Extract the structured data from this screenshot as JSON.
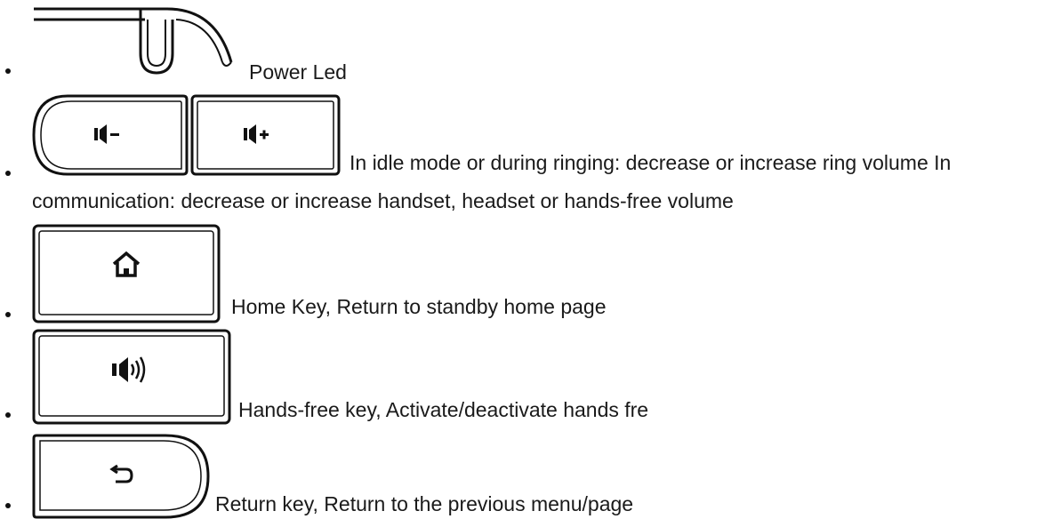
{
  "items": [
    {
      "icon": "power-led-icon",
      "text": "Power Led"
    },
    {
      "icon": "volume-keys-icon",
      "text": "In idle mode or during ringing: decrease or increase ring volume In",
      "text_cont": "communication: decrease or increase handset, headset or hands-free volume"
    },
    {
      "icon": "home-key-icon",
      "text": "Home Key, Return to standby home page"
    },
    {
      "icon": "hands-free-key-icon",
      "text": "Hands-free key, Activate/deactivate hands fre"
    },
    {
      "icon": "return-key-icon",
      "text": "Return key, Return to the previous menu/page"
    }
  ],
  "colors": {
    "text": "#1a1a1a",
    "line": "#111111",
    "background": "#ffffff"
  }
}
